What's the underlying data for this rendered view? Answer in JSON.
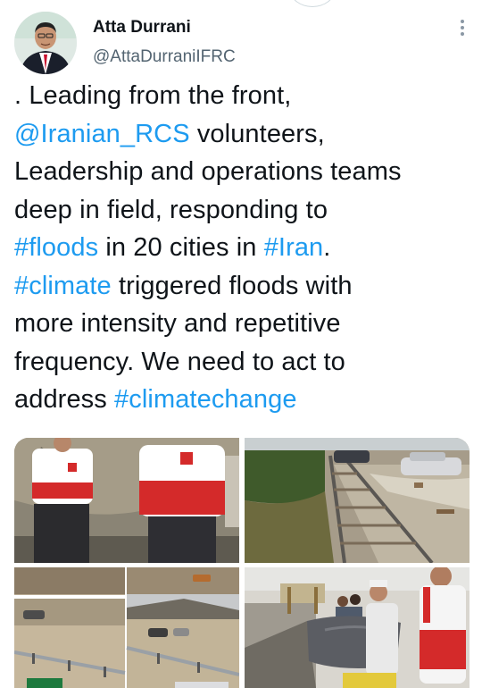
{
  "author": {
    "name": "Atta Durrani",
    "handle": "@AttaDurraniIFRC"
  },
  "tweet": {
    "seg1": ". Leading from the front,",
    "mention": "@Iranian_RCS",
    "seg2": " volunteers,",
    "line3": "Leadership and operations teams",
    "line4": "deep in field, responding to",
    "tag_floods": "#floods",
    "seg5": " in 20 cities in ",
    "tag_iran": "#Iran",
    "seg6": ".",
    "tag_climate": "#climate",
    "seg7": " triggered floods with",
    "line8": "more intensity and repetitive",
    "line9": "frequency. We need to act to",
    "seg10": "address ",
    "tag_climatechange": "#climatechange"
  },
  "colors": {
    "link": "#1d9bf0",
    "text": "#0f1419",
    "secondary": "#536471",
    "rcs_red": "#d42a2a"
  },
  "icons": {
    "more": "more-options-icon"
  }
}
